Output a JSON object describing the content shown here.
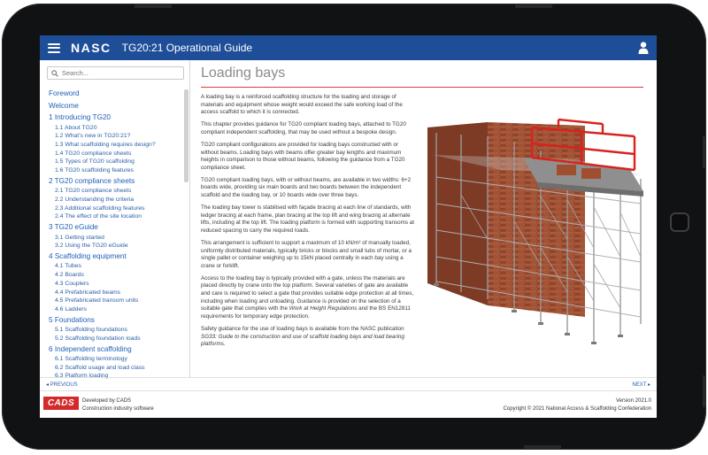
{
  "header": {
    "brand": "NASC",
    "title": "TG20:21 Operational Guide"
  },
  "sidebar": {
    "search_placeholder": "Search...",
    "toc": [
      {
        "label": "Foreword",
        "items": []
      },
      {
        "label": "Welcome",
        "items": []
      },
      {
        "label": "1 Introducing TG20",
        "items": [
          "1.1 About TG20",
          "1.2 What's new in TG20:21?",
          "1.3 What scaffolding requires design?",
          "1.4 TG20 compliance sheets",
          "1.5 Types of TG20 scaffolding",
          "1.6 TG20 scaffolding features"
        ]
      },
      {
        "label": "2 TG20 compliance sheets",
        "items": [
          "2.1 TG20 compliance sheets",
          "2.2 Understanding the criteria",
          "2.3 Additional scaffolding features",
          "2.4 The effect of the site location"
        ]
      },
      {
        "label": "3 TG20 eGuide",
        "items": [
          "3.1 Getting started",
          "3.2 Using the TG20 eGuide"
        ]
      },
      {
        "label": "4 Scaffolding equipment",
        "items": [
          "4.1 Tubes",
          "4.2 Boards",
          "4.3 Couplers",
          "4.4 Prefabricated beams",
          "4.5 Prefabricated transom units",
          "4.6 Ladders"
        ]
      },
      {
        "label": "5 Foundations",
        "items": [
          "5.1 Scaffolding foundations",
          "5.2 Scaffolding foundation loads"
        ]
      },
      {
        "label": "6 Independent scaffolding",
        "items": [
          "6.1 Scaffolding terminology",
          "6.2 Scaffold usage and load class",
          "6.3 Platform loading"
        ]
      }
    ]
  },
  "main": {
    "title": "Loading bays",
    "p1": "A loading bay is a reinforced scaffolding structure for the loading and storage of materials and equipment whose weight would exceed the safe working load of the access scaffold to which it is connected.",
    "p2": "This chapter provides guidance for TG20 compliant loading bays, attached to TG20 compliant independent scaffolding, that may be used without a bespoke design.",
    "p3": "TG20 compliant configurations are provided for loading bays constructed with or without beams. Loading bays with beams offer greater bay lengths and maximum heights in comparison to those without beams, following the guidance from a TG20 compliance sheet.",
    "p4": "TG20 compliant loading bays, with or without beams, are available in two widths: 6+2 boards wide, providing six main boards and two boards between the independent scaffold and the loading bay, or 10 boards wide over three bays.",
    "p5": "The loading bay tower is stabilised with façade bracing at each line of standards, with ledger bracing at each frame, plan bracing at the top lift and wing bracing at alternate lifts, including at the top lift. The loading platform is formed with supporting transoms at reduced spacing to carry the required loads.",
    "p6": "This arrangement is sufficient to support a maximum of 10 kN/m² of manually loaded, uniformly distributed materials, typically bricks or blocks and small tubs of mortar, or a single pallet or container weighing up to 15kN placed centrally in each bay using a crane or forklift.",
    "p7a": "Access to the loading bay is typically provided with a gate, unless the materials are placed directly by crane onto the top platform. Several varieties of gate are available and care is required to select a gate that provides suitable edge protection at all times, including when loading and unloading. Guidance is provided on the selection of a suitable gate that complies with the ",
    "p7em": "Work at Height Regulations",
    "p7b": " and the BS EN12811 requirements for temporary edge protection.",
    "p8a": "Safety guidance for the use of loading bays is available from the NASC publication ",
    "p8em": "SG33: Guide to the construction and use of scaffold loading bays and load bearing platforms."
  },
  "nav": {
    "prev": "◂ PREVIOUS",
    "next": "NEXT ▸"
  },
  "footer": {
    "logo": "CADS",
    "dev_line1": "Developed by CADS",
    "dev_line2": "Construction industry software",
    "version": "Version 2021.0",
    "copyright": "Copyright © 2021 National Access & Scaffolding Confederation"
  },
  "colors": {
    "header_bg": "#1f4e99",
    "accent_red": "#e23a3a",
    "link_blue": "#1f5fb8"
  }
}
